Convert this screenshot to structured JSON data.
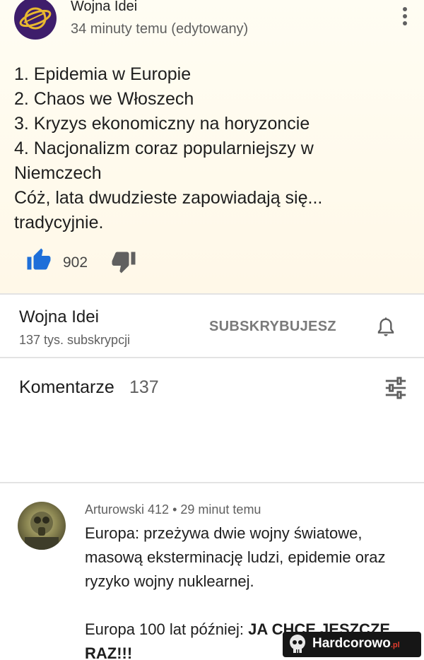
{
  "post": {
    "channel_name": "Wojna Idei",
    "time": "34 minuty temu (edytowany)",
    "lines": [
      "1. Epidemia w Europie",
      "2. Chaos we Włoszech",
      "3. Kryzys ekonomiczny na horyzoncie",
      "4. Nacjonalizm coraz popularniejszy w",
      "Niemczech",
      "Cóż, lata dwudzieste zapowiadają się...",
      "tradycyjnie."
    ],
    "likes": "902",
    "icons": {
      "menu": "more-vert-icon",
      "like": "thumb-up-icon",
      "dislike": "thumb-down-icon"
    }
  },
  "subscription": {
    "channel_name": "Wojna Idei",
    "subscribers": "137 tys. subskrypcji",
    "button_label": "SUBSKRYBUJESZ",
    "bell_icon": "bell-icon"
  },
  "comments": {
    "title": "Komentarze",
    "count": "137",
    "sort_icon": "sort-icon",
    "items": [
      {
        "author": "Arturowski 412",
        "time": "29 minut temu",
        "lines": [
          "Europa: przeżywa dwie wojny światowe,",
          "masową eksterminację ludzi, epidemie oraz",
          "ryzyko wojny nuklearnej."
        ],
        "line2_prefix": "Europa 100 lat później: ",
        "line2_bold": "JA CHCE JESZCZE",
        "line3_bold": "RAZ!!!"
      }
    ]
  },
  "watermark": {
    "text": "Hardcorowo",
    "suffix": ".pl"
  },
  "colors": {
    "like_blue": "#1e6fd9",
    "icon_gray": "#606060",
    "post_bg": "#fffaee",
    "divider": "#e3e3e3"
  }
}
